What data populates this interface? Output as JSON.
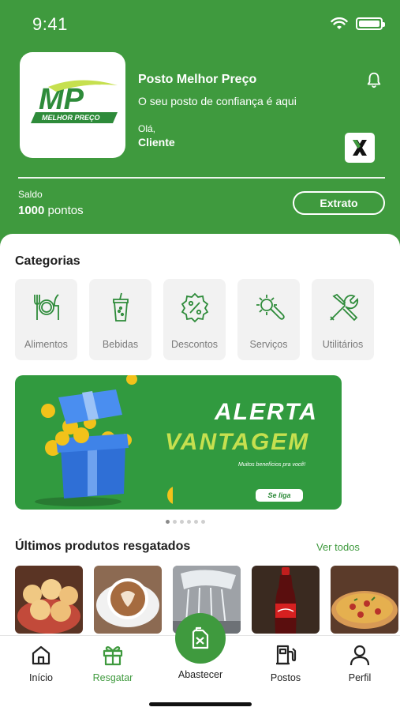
{
  "status_bar": {
    "time": "9:41"
  },
  "header": {
    "logo_text": "MP",
    "logo_subtext": "MELHOR PREÇO",
    "store_name": "Posto Melhor Preço",
    "tagline": "O seu posto de confiança é aqui",
    "greeting": "Olá,",
    "customer_name": "Cliente",
    "balance_label": "Saldo",
    "balance_points": "1000",
    "balance_unit": "pontos",
    "statement_button": "Extrato"
  },
  "categories": {
    "title": "Categorias",
    "items": [
      {
        "label": "Alimentos",
        "icon": "cutlery-icon"
      },
      {
        "label": "Bebidas",
        "icon": "drink-cup-icon"
      },
      {
        "label": "Descontos",
        "icon": "percent-badge-icon"
      },
      {
        "label": "Serviços",
        "icon": "gear-wrench-icon"
      },
      {
        "label": "Utilitários",
        "icon": "tools-icon"
      }
    ]
  },
  "banner": {
    "title_line1": "ALERTA",
    "title_line2": "VANTAGEM",
    "subtitle": "Muitos benefícios pra você!",
    "cta": "Se liga",
    "total_slides": 6,
    "active_slide": 1
  },
  "recent": {
    "title": "Últimos produtos resgatados",
    "view_all": "Ver todos",
    "products": [
      "pao-de-queijo",
      "cappuccino",
      "car-wash",
      "coca-cola",
      "pizza"
    ]
  },
  "tabbar": {
    "items": [
      {
        "label": "Início",
        "icon": "home-icon"
      },
      {
        "label": "Resgatar",
        "icon": "gift-icon",
        "active": true
      },
      {
        "label": "Abastecer",
        "icon": "fuel-can-icon"
      },
      {
        "label": "Postos",
        "icon": "fuel-pump-icon"
      },
      {
        "label": "Perfil",
        "icon": "user-icon"
      }
    ]
  },
  "colors": {
    "brand_green": "#3f9a3e",
    "banner_green": "#319a3f",
    "lime": "#c6e04f"
  }
}
